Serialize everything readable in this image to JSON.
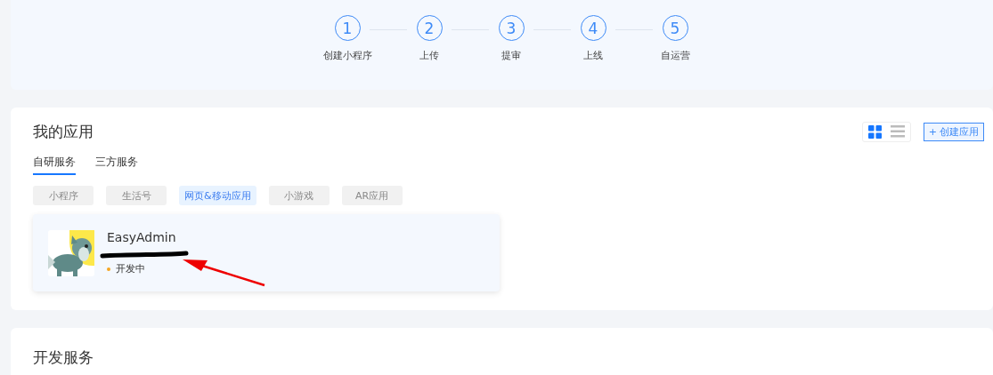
{
  "steps": [
    {
      "number": "1",
      "label": "创建小程序"
    },
    {
      "number": "2",
      "label": "上传"
    },
    {
      "number": "3",
      "label": "提审"
    },
    {
      "number": "4",
      "label": "上线"
    },
    {
      "number": "5",
      "label": "自运营"
    }
  ],
  "my_apps": {
    "title": "我的应用",
    "view_modes": [
      {
        "kind": "grid",
        "selected": true
      },
      {
        "kind": "list",
        "selected": false
      }
    ],
    "create_button": {
      "icon": "+",
      "label": "创建应用"
    },
    "tabs": [
      {
        "label": "自研服务",
        "selected": true
      },
      {
        "label": "三方服务",
        "selected": false
      }
    ],
    "categories": [
      {
        "label": "小程序",
        "selected": false
      },
      {
        "label": "生活号",
        "selected": false
      },
      {
        "label": "网页&移动应用",
        "selected": true
      },
      {
        "label": "小游戏",
        "selected": false
      },
      {
        "label": "AR应用",
        "selected": false
      }
    ],
    "apps": [
      {
        "name": "EasyAdmin",
        "status": "开发中",
        "id_redacted": true,
        "arrow_annotation": true
      }
    ]
  },
  "dev_services": {
    "title": "开发服务"
  }
}
